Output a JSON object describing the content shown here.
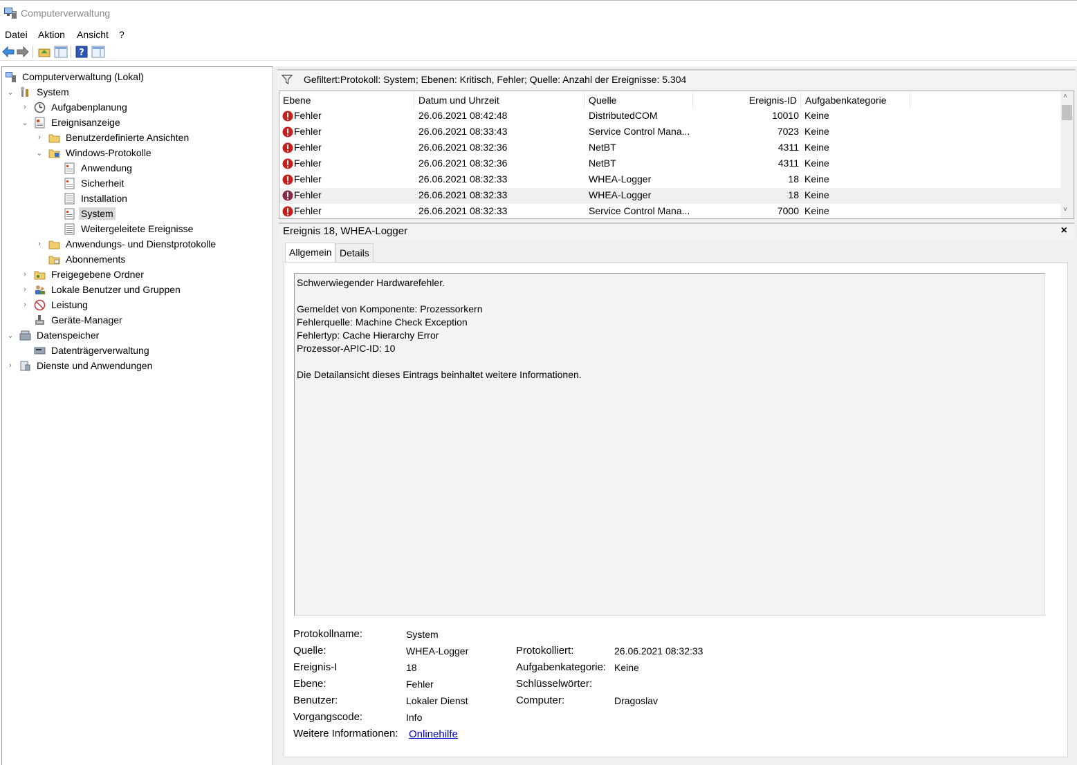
{
  "window": {
    "title": "Computerverwaltung"
  },
  "menu": [
    "Datei",
    "Aktion",
    "Ansicht",
    "?"
  ],
  "tree": {
    "items": [
      {
        "label": "Computerverwaltung (Lokal)"
      },
      {
        "label": "System"
      },
      {
        "label": "Aufgabenplanung"
      },
      {
        "label": "Ereignisanzeige"
      },
      {
        "label": "Benutzerdefinierte Ansichten"
      },
      {
        "label": "Windows-Protokolle"
      },
      {
        "label": "Anwendung"
      },
      {
        "label": "Sicherheit"
      },
      {
        "label": "Installation"
      },
      {
        "label": "System"
      },
      {
        "label": "Weitergeleitete Ereignisse"
      },
      {
        "label": "Anwendungs- und Dienstprotokolle"
      },
      {
        "label": "Abonnements"
      },
      {
        "label": "Freigegebene Ordner"
      },
      {
        "label": "Lokale Benutzer und Gruppen"
      },
      {
        "label": "Leistung"
      },
      {
        "label": "Geräte-Manager"
      },
      {
        "label": "Datenspeicher"
      },
      {
        "label": "Datenträgerverwaltung"
      },
      {
        "label": "Dienste und Anwendungen"
      }
    ]
  },
  "filter": {
    "text": "Gefiltert:Protokoll: System; Ebenen: Kritisch, Fehler; Quelle:  Anzahl der Ereignisse: 5.304"
  },
  "grid": {
    "columns": [
      "Ebene",
      "Datum und Uhrzeit",
      "Quelle",
      "Ereignis-ID",
      "Aufgabenkategorie"
    ],
    "rows": [
      {
        "level": "Fehler",
        "datetime": "26.06.2021 08:42:48",
        "source": "DistributedCOM",
        "id": "10010",
        "category": "Keine"
      },
      {
        "level": "Fehler",
        "datetime": "26.06.2021 08:33:43",
        "source": "Service Control Mana...",
        "id": "7023",
        "category": "Keine"
      },
      {
        "level": "Fehler",
        "datetime": "26.06.2021 08:32:36",
        "source": "NetBT",
        "id": "4311",
        "category": "Keine"
      },
      {
        "level": "Fehler",
        "datetime": "26.06.2021 08:32:36",
        "source": "NetBT",
        "id": "4311",
        "category": "Keine"
      },
      {
        "level": "Fehler",
        "datetime": "26.06.2021 08:32:33",
        "source": "WHEA-Logger",
        "id": "18",
        "category": "Keine"
      },
      {
        "level": "Fehler",
        "datetime": "26.06.2021 08:32:33",
        "source": "WHEA-Logger",
        "id": "18",
        "category": "Keine"
      },
      {
        "level": "Fehler",
        "datetime": "26.06.2021 08:32:33",
        "source": "Service Control Mana...",
        "id": "7000",
        "category": "Keine"
      }
    ],
    "up_arrow": "˄",
    "down_arrow": "˅"
  },
  "detail": {
    "title": "Ereignis 18, WHEA-Logger",
    "close": "×",
    "tabs": [
      "Allgemein",
      "Details"
    ],
    "message": "Schwerwiegender Hardwarefehler.\n\nGemeldet von Komponente: Prozessorkern\nFehlerquelle: Machine Check Exception\nFehlertyp: Cache Hierarchy Error\nProzessor-APIC-ID: 10\n\nDie Detailansicht dieses Eintrags beinhaltet weitere Informationen.",
    "props": {
      "protokollname_label": "Protokollname:",
      "protokollname": "System",
      "quelle_label": "Quelle:",
      "quelle": "WHEA-Logger",
      "ereignis_label": "Ereignis-I",
      "ereignis": "18",
      "ebene_label": "Ebene:",
      "ebene": "Fehler",
      "benutzer_label": "Benutzer:",
      "benutzer": "Lokaler Dienst",
      "vorgangscode_label": "Vorgangscode:",
      "vorgangscode": "Info",
      "weitere_label": "Weitere Informationen:",
      "weitere_link": "Onlinehilfe",
      "protokolliert_label": "Protokolliert:",
      "protokolliert": "26.06.2021 08:32:33",
      "aufgabenkategorie_label": "Aufgabenkategorie:",
      "aufgabenkategorie": "Keine",
      "schluessel_label": "Schlüsselwörter:",
      "computer_label": "Computer:",
      "computer": "Dragoslav"
    }
  }
}
